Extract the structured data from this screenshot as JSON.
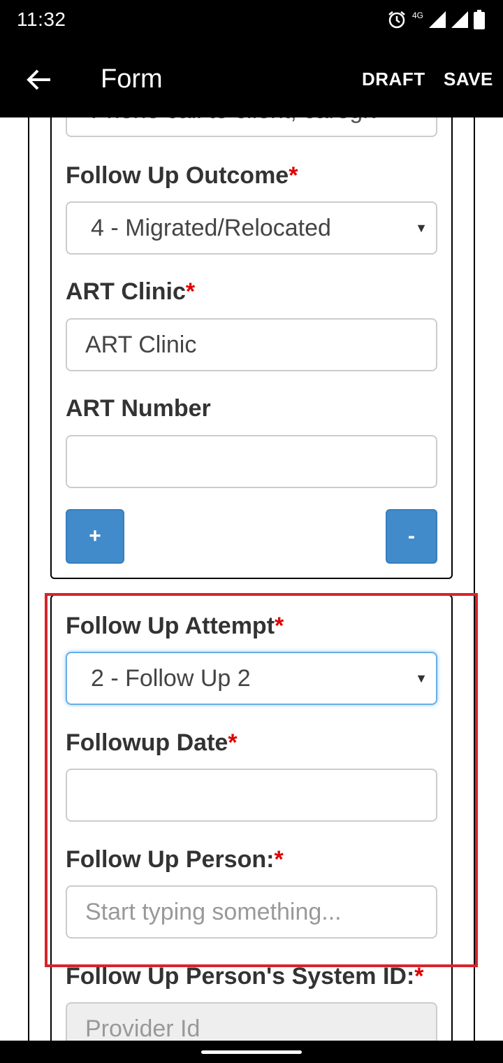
{
  "status_bar": {
    "time": "11:32",
    "network_label": "4G",
    "icons": [
      "alarm-icon",
      "signal-icon",
      "signal-icon",
      "battery-icon"
    ]
  },
  "app_bar": {
    "title": "Form",
    "draft_label": "DRAFT",
    "save_label": "SAVE",
    "back_icon": "arrow-left-icon"
  },
  "form": {
    "truncated_field_value": "Phone call to client, caregiv",
    "follow_up_outcome": {
      "label": "Follow Up Outcome",
      "required_mark": "*",
      "value": "4 - Migrated/Relocated"
    },
    "art_clinic": {
      "label": "ART Clinic",
      "required_mark": "*",
      "value": "ART Clinic"
    },
    "art_number": {
      "label": "ART Number",
      "value": ""
    },
    "add_button": "+",
    "remove_button": "-",
    "follow_up_attempt": {
      "label": "Follow Up Attempt",
      "required_mark": "*",
      "value": "2 - Follow Up 2"
    },
    "followup_date": {
      "label": "Followup Date",
      "required_mark": "*",
      "value": ""
    },
    "follow_up_person": {
      "label": "Follow Up Person:",
      "required_mark": "*",
      "placeholder": "Start typing something..."
    },
    "follow_up_person_system_id": {
      "label": "Follow Up Person's System ID:",
      "required_mark": "*",
      "placeholder": "Provider Id"
    }
  },
  "colors": {
    "required": "#e00000",
    "button": "#428bca",
    "highlight": "#d9232d",
    "focus": "#66afe9"
  }
}
